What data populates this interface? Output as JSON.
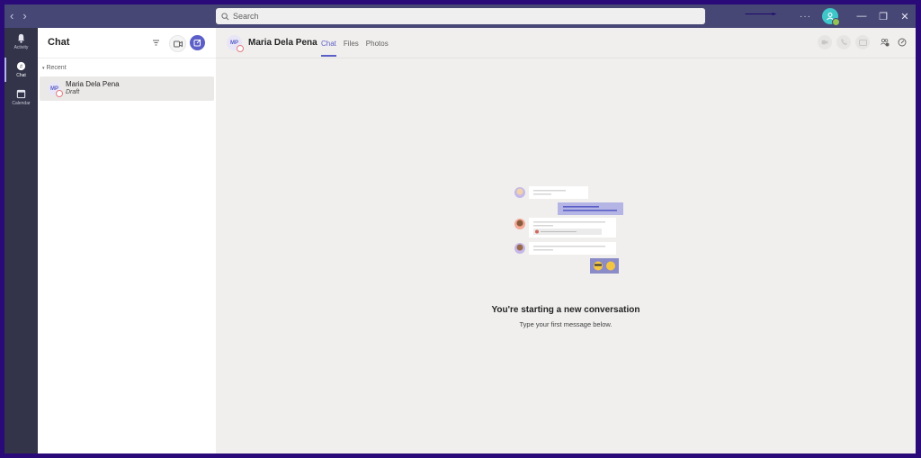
{
  "titlebar": {
    "search_placeholder": "Search",
    "more_label": "···",
    "minimize": "—",
    "maximize": "❐",
    "close": "✕",
    "back": "‹",
    "forward": "›"
  },
  "rail": {
    "items": [
      {
        "label": "Activity",
        "icon": "bell-icon"
      },
      {
        "label": "Chat",
        "icon": "chat-icon",
        "active": true
      },
      {
        "label": "Calendar",
        "icon": "calendar-icon"
      }
    ]
  },
  "chat_list": {
    "title": "Chat",
    "section": "Recent",
    "items": [
      {
        "initials": "MP",
        "name": "Maria Dela Pena",
        "subtitle": "Draft"
      }
    ]
  },
  "conversation": {
    "initials": "MP",
    "name": "Maria Dela Pena",
    "tabs": [
      {
        "label": "Chat",
        "active": true
      },
      {
        "label": "Files"
      },
      {
        "label": "Photos"
      }
    ],
    "empty_title": "You're starting a new conversation",
    "empty_subtitle": "Type your first message below."
  },
  "colors": {
    "accent": "#5b5fc7",
    "titlebar": "#464775",
    "rail": "#33344a",
    "frame": "#2a0a78"
  }
}
